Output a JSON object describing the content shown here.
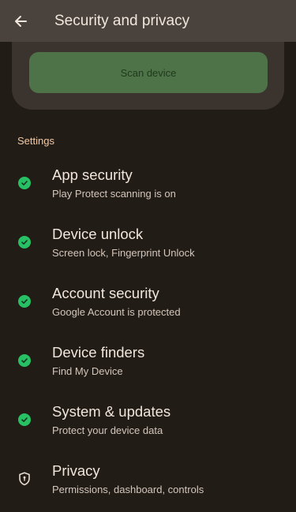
{
  "app_bar": {
    "title": "Security and privacy"
  },
  "scan": {
    "button_label": "Scan device"
  },
  "settings": {
    "section_label": "Settings",
    "items": [
      {
        "title": "App security",
        "subtitle": "Play Protect scanning is on",
        "icon": "check-circle-icon"
      },
      {
        "title": "Device unlock",
        "subtitle": "Screen lock, Fingerprint Unlock",
        "icon": "check-circle-icon"
      },
      {
        "title": "Account security",
        "subtitle": "Google Account is protected",
        "icon": "check-circle-icon"
      },
      {
        "title": "Device finders",
        "subtitle": "Find My Device",
        "icon": "check-circle-icon"
      },
      {
        "title": "System & updates",
        "subtitle": "Protect your device data",
        "icon": "check-circle-icon"
      },
      {
        "title": "Privacy",
        "subtitle": "Permissions, dashboard, controls",
        "icon": "privacy-shield-icon"
      }
    ]
  },
  "colors": {
    "status_ok": "#28c064",
    "accent": "#f3c9a4",
    "scan_button": "#4e7348"
  }
}
